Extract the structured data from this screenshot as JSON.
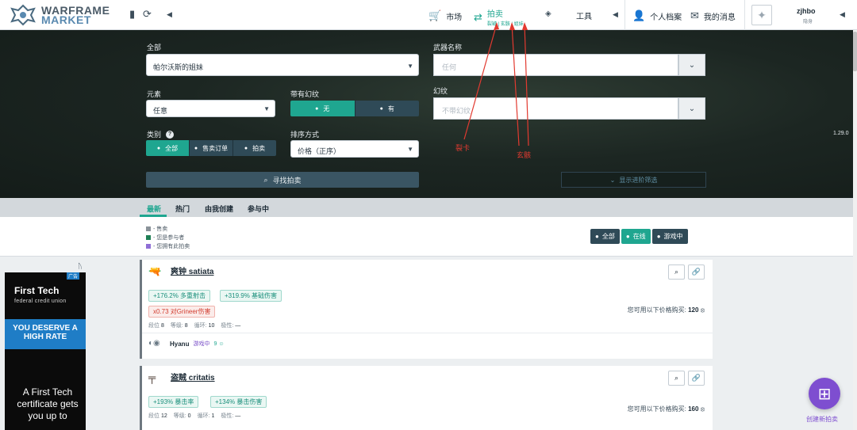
{
  "nav": {
    "logo_line1": "WARFRAME",
    "logo_line2": "MARKET",
    "market": "市场",
    "auctions": "拍卖",
    "auction_sub": "裂罅 | 玄骸 | 姐妹",
    "tools": "工具",
    "profile": "个人档案",
    "messages": "我的消息",
    "username": "zjhbo",
    "user_status": "隐身"
  },
  "filters": {
    "type_label": "全部",
    "type_value": "帕尔沃斯的姐妹",
    "weapon_label": "武器名称",
    "weapon_placeholder": "任何",
    "element_label": "元素",
    "element_value": "任意",
    "ephemera_label": "带有幻纹",
    "ephemera_options": [
      "无",
      "有"
    ],
    "ephemera_selected": 0,
    "glyph_label": "幻纹",
    "glyph_placeholder": "不带幻纹",
    "category_label": "类别",
    "category_options": [
      "全部",
      "售卖订单",
      "拍卖"
    ],
    "sort_label": "排序方式",
    "sort_value": "价格（正序）",
    "search_button": "寻找拍卖",
    "advanced_button": "显示进阶筛选",
    "version": "1.29.0"
  },
  "annotations": {
    "riven": "裂卡",
    "lich": "玄骸"
  },
  "tabs": [
    "最新",
    "热门",
    "由我创建",
    "参与中"
  ],
  "legend": [
    {
      "label": "- 售卖",
      "color": "#8a9299"
    },
    {
      "label": "- 您是参与者",
      "color": "#1f7f55"
    },
    {
      "label": "- 您拥有此拍卖",
      "color": "#8f6fd6"
    }
  ],
  "status_filter": {
    "options": [
      "全部",
      "在线",
      "游戏中"
    ],
    "selected": 1
  },
  "auctions": [
    {
      "name": "爽钟 satiata",
      "stats_pos": [
        "+176.2% 多重射击",
        "+319.9% 基础伤害"
      ],
      "stats_neg": [
        "x0.73 对Grineer伤害"
      ],
      "meta": {
        "rank_label": "段位",
        "rank": "8",
        "mastery_label": "等级:",
        "mastery": "8",
        "rolls_label": "循环:",
        "rolls": "10",
        "polarity_label": "极性:",
        "polarity": "—"
      },
      "price_text": "您可用以下价格购买:",
      "price": "120",
      "seller": "Hyanu",
      "seller_status": "游戏中",
      "seller_rep": "9"
    },
    {
      "name": "盗贼 critatis",
      "stats_pos": [
        "+193% 暴击率",
        "+134% 暴击伤害"
      ],
      "stats_neg": [],
      "meta": {
        "rank_label": "段位",
        "rank": "12",
        "mastery_label": "等级:",
        "mastery": "0",
        "rolls_label": "循环:",
        "rolls": "1",
        "polarity_label": "极性:",
        "polarity": "—"
      },
      "price_text": "您可用以下价格购买:",
      "price": "160"
    }
  ],
  "ad": {
    "brand": "First Tech",
    "sub": "federal credit union",
    "tag": "广告",
    "band": "YOU DESERVE A HIGH RATE",
    "copy": "A First Tech certificate gets you up to"
  },
  "fab_label": "创建新拍卖",
  "colors": {
    "accent": "#1fa690",
    "dark_button": "#2f4a57",
    "fab": "#7e4ed0",
    "negative": "#d23d30"
  }
}
